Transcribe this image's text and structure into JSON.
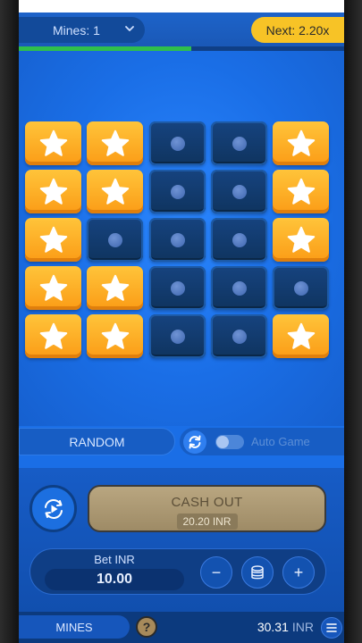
{
  "header": {
    "mines_label": "Mines: 1",
    "next_label": "Next: 2.20x",
    "progress_fraction": 0.53
  },
  "grid": {
    "rows": [
      [
        "star",
        "star",
        "empty",
        "empty",
        "star"
      ],
      [
        "star",
        "star",
        "empty",
        "empty",
        "star"
      ],
      [
        "star",
        "empty",
        "empty",
        "empty",
        "star"
      ],
      [
        "star",
        "star",
        "empty",
        "empty",
        "empty"
      ],
      [
        "star",
        "star",
        "empty",
        "empty",
        "star"
      ]
    ]
  },
  "controls": {
    "random_label": "RANDOM",
    "auto_game_label": "Auto Game",
    "auto_game_on": false
  },
  "cashout": {
    "label": "CASH OUT",
    "amount": "20.20 INR"
  },
  "bet": {
    "label": "Bet INR",
    "value": "10.00",
    "minus": "−",
    "plus": "+"
  },
  "footer": {
    "mines_tab": "MINES",
    "help": "?",
    "balance": "30.31",
    "currency": "INR"
  },
  "colors": {
    "accent_yellow": "#f7c326",
    "board_blue": "#1a6ee6",
    "star_tile": "#fbb12a",
    "empty_tile": "#12396b",
    "progress_green": "#2fbf4b"
  },
  "icons": {
    "mines_chevron": "chevron-down-icon",
    "tile_star": "star-icon",
    "tile_dot": "dot-icon",
    "refresh": "refresh-icon",
    "play": "autoplay-icon",
    "coins": "coins-stack-icon",
    "menu": "menu-icon"
  }
}
